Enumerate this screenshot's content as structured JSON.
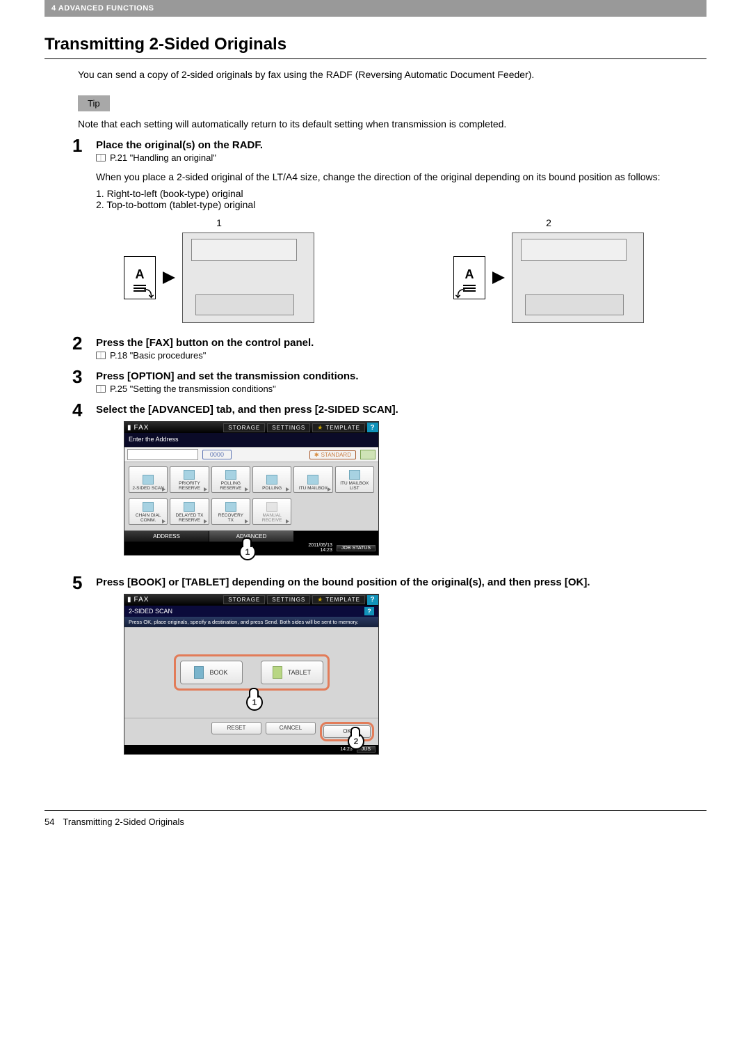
{
  "chapter_bar": "4 ADVANCED FUNCTIONS",
  "title": "Transmitting 2-Sided Originals",
  "intro": "You can send a copy of 2-sided originals by fax using the RADF (Reversing Automatic Document Feeder).",
  "tip_label": "Tip",
  "tip_text": "Note that each setting will automatically return to its default setting when transmission is completed.",
  "steps": {
    "s1": {
      "title": "Place the original(s) on the RADF.",
      "ref": "P.21 \"Handling an original\"",
      "note": "When you place a 2-sided original of the LT/A4 size, change the direction of the original depending on its bound position as follows:",
      "sub1": "1. Right-to-left (book-type) original",
      "sub2": "2. Top-to-bottom (tablet-type) original"
    },
    "s2": {
      "title": "Press the [FAX] button on the control panel.",
      "ref": "P.18 \"Basic procedures\""
    },
    "s3": {
      "title": "Press [OPTION] and set the transmission conditions.",
      "ref": "P.25 \"Setting the transmission conditions\""
    },
    "s4": {
      "title": "Select the [ADVANCED] tab, and then press [2-SIDED SCAN]."
    },
    "s5": {
      "title": "Press [BOOK] or [TABLET] depending on the bound position of the original(s), and then press [OK]."
    }
  },
  "diagram": {
    "col1_header": "1",
    "col2_header": "2",
    "page_letter": "A"
  },
  "ui1": {
    "fax_label": "FAX",
    "storage": "STORAGE",
    "settings": "SETTINGS",
    "template": "TEMPLATE",
    "help": "?",
    "enter_addr": "Enter the Address",
    "count": "0000",
    "standard": "STANDARD",
    "btns": {
      "b1": "2-SIDED SCAN",
      "b2a": "PRIORITY",
      "b2b": "RESERVE",
      "b3a": "POLLING",
      "b3b": "RESERVE",
      "b4": "POLLING",
      "b5": "ITU MAILBOX",
      "b6a": "ITU MAILBOX",
      "b6b": "LIST",
      "r2b1a": "CHAIN DIAL",
      "r2b1b": "COMM.",
      "r2b2a": "DELAYED TX",
      "r2b2b": "RESERVE",
      "r2b3a": "RECOVERY",
      "r2b3b": "TX",
      "r2b4a": "MANUAL",
      "r2b4b": "RECEIVE"
    },
    "tab_address": "ADDRESS",
    "tab_advanced": "ADVANCED",
    "datetime": "2011/05/13\n14:23",
    "jobstatus": "JOB STATUS",
    "callout": "1"
  },
  "ui2": {
    "fax_label": "FAX",
    "storage": "STORAGE",
    "settings": "SETTINGS",
    "template": "TEMPLATE",
    "help": "?",
    "sub1": "2-SIDED SCAN",
    "instruct": "Press OK, place originals, specify a destination, and press Send. Both sides will be sent to memory.",
    "book": "BOOK",
    "tablet": "TABLET",
    "reset": "RESET",
    "cancel": "CANCEL",
    "ok": "OK",
    "datetime": "14:23",
    "jobstatus_short": "JUS",
    "callout1": "1",
    "callout2": "2"
  },
  "footer": {
    "page_num": "54",
    "title": "Transmitting 2-Sided Originals"
  }
}
